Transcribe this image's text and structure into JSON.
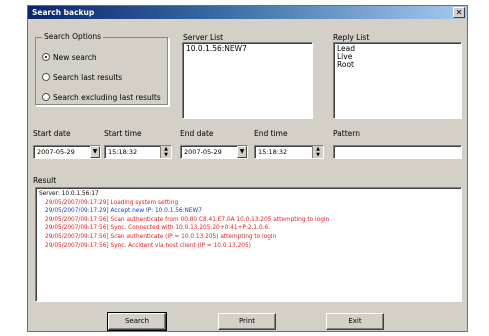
{
  "window": {
    "title": "Search backup",
    "close_glyph": "✕"
  },
  "search_options": {
    "label": "Search Options",
    "options": [
      {
        "label": "New search",
        "checked": true
      },
      {
        "label": "Search last results",
        "checked": false
      },
      {
        "label": "Search excluding last results",
        "checked": false
      }
    ]
  },
  "server_list": {
    "label": "Server List",
    "items": [
      "10.0.1.56:NEW7"
    ]
  },
  "reply_list": {
    "label": "Reply List",
    "items": [
      "Lead",
      "Live",
      "Root"
    ]
  },
  "start_date": {
    "label": "Start date",
    "value": "2007-05-29"
  },
  "start_time": {
    "label": "Start time",
    "value": "15:18:32"
  },
  "end_date": {
    "label": "End date",
    "value": "2007-05-29"
  },
  "end_time": {
    "label": "End time",
    "value": "15:18:32"
  },
  "pattern": {
    "label": "Pattern",
    "value": ""
  },
  "result": {
    "label": "Result",
    "lines": [
      {
        "ts": "",
        "msg": "Server: 10.0.1.56:17",
        "kind": "first"
      },
      {
        "ts": "29/05/2007/09:17:29]",
        "msg": " Loading system setting",
        "kind": "red"
      },
      {
        "ts": "29/05/2007/09:17:29]",
        "msg": " Accept new IP: 10.0.1.56:NEW7",
        "kind": "blue"
      },
      {
        "ts": "29/05/2007/09:17:56]",
        "msg": " Scan authenticate from 00.80.C8.41.E7.0A 10.0.13.205 attempting to login",
        "kind": "red"
      },
      {
        "ts": "29/05/2007/09:17:56]",
        "msg": " Sync. Connected with 10.0.13.205:20+0:41+P:2.1.0.6.",
        "kind": "red"
      },
      {
        "ts": "29/05/2007/09:17:56]",
        "msg": " Scan authenticate (IP = 10.0.13.205) attempting to login",
        "kind": "red"
      },
      {
        "ts": "29/05/2007/09:17:56]",
        "msg": " Sync. Accident via host client (IP = 10.0.13.205)",
        "kind": "red"
      }
    ]
  },
  "buttons": {
    "search": "Search",
    "print": "Print",
    "exit": "Exit"
  },
  "icons": {
    "dropdown": "▼",
    "spin_up": "▲",
    "spin_down": "▼"
  }
}
